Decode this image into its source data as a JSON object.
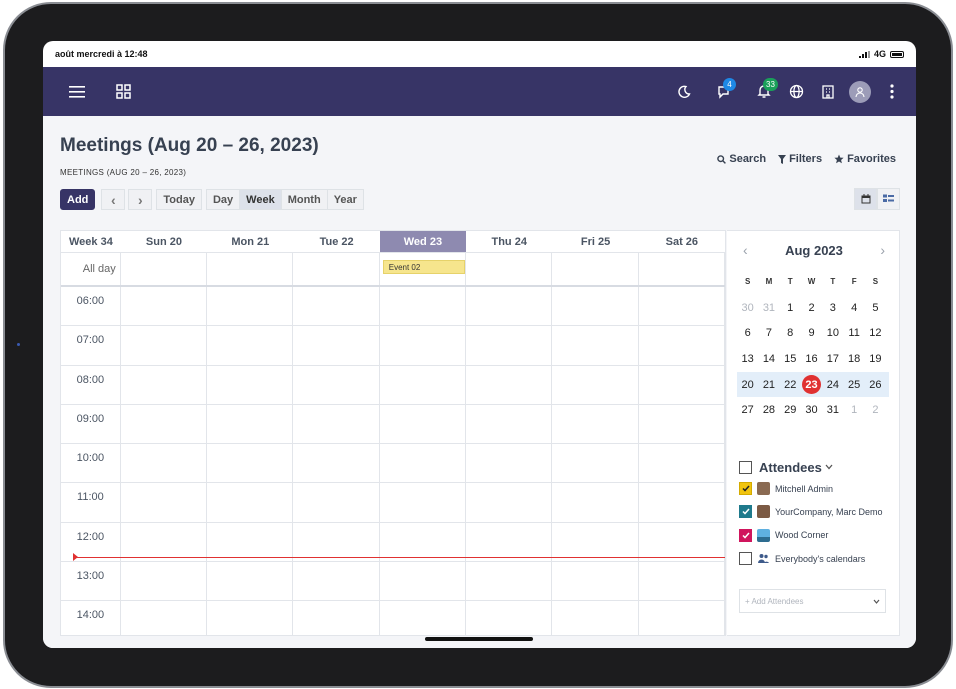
{
  "status": {
    "datetime": "août mercredi à 12:48",
    "network": "4G"
  },
  "nav": {
    "discuss_badge": "4",
    "activity_badge": "33"
  },
  "page": {
    "title": "Meetings (Aug 20 – 26, 2023)",
    "breadcrumb": "MEETINGS (AUG 20 – 26, 2023)",
    "search": "Search",
    "filters": "Filters",
    "favorites": "Favorites"
  },
  "toolbar": {
    "add": "Add",
    "prev": "‹",
    "next": "›",
    "today": "Today",
    "day": "Day",
    "week": "Week",
    "month": "Month",
    "year": "Year"
  },
  "calendar": {
    "week_label": "Week 34",
    "days": [
      "Sun 20",
      "Mon 21",
      "Tue 22",
      "Wed 23",
      "Thu 24",
      "Fri 25",
      "Sat 26"
    ],
    "allday_label": "All day",
    "event": "Event 02",
    "hours": [
      "06:00",
      "07:00",
      "08:00",
      "09:00",
      "10:00",
      "11:00",
      "12:00",
      "13:00",
      "14:00"
    ]
  },
  "mini_calendar": {
    "title": "Aug 2023",
    "prev": "‹",
    "next": "›",
    "dow": [
      "S",
      "M",
      "T",
      "W",
      "T",
      "F",
      "S"
    ],
    "weeks": [
      [
        "30",
        "31",
        "1",
        "2",
        "3",
        "4",
        "5"
      ],
      [
        "6",
        "7",
        "8",
        "9",
        "10",
        "11",
        "12"
      ],
      [
        "13",
        "14",
        "15",
        "16",
        "17",
        "18",
        "19"
      ],
      [
        "20",
        "21",
        "22",
        "23",
        "24",
        "25",
        "26"
      ],
      [
        "27",
        "28",
        "29",
        "30",
        "31",
        "1",
        "2"
      ]
    ]
  },
  "attendees": {
    "title": "Attendees",
    "items": [
      "Mitchell Admin",
      "YourCompany, Marc Demo",
      "Wood Corner",
      "Everybody's calendars"
    ],
    "add_placeholder": "+ Add Attendees"
  }
}
